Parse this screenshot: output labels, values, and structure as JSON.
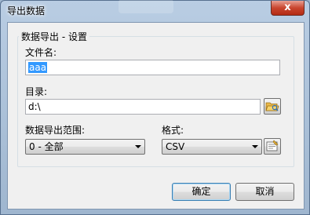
{
  "window": {
    "title": "导出数据",
    "close_label": "x"
  },
  "group": {
    "legend": "数据导出 - 设置"
  },
  "filename": {
    "label": "文件名:",
    "value": "aaa"
  },
  "directory": {
    "label": "目录:",
    "value": "d:\\",
    "browse_icon": "folder-open-icon"
  },
  "range": {
    "label": "数据导出范围:",
    "selected": "0 - 全部"
  },
  "format": {
    "label": "格式:",
    "selected": "CSV",
    "settings_icon": "format-settings-icon"
  },
  "buttons": {
    "ok": "确定",
    "cancel": "取消"
  }
}
